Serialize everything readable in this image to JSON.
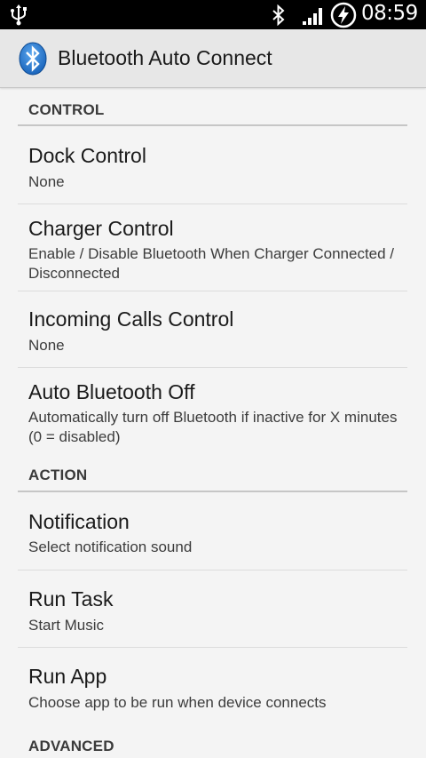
{
  "status_bar": {
    "time": "08:59",
    "icons": [
      "usb-icon",
      "bluetooth-icon",
      "signal-icon",
      "battery-charging-icon"
    ]
  },
  "action_bar": {
    "title": "Bluetooth Auto Connect",
    "icon": "bluetooth-app-icon",
    "accent_color": "#1e6fc5"
  },
  "categories": {
    "control": "CONTROL",
    "action": "ACTION",
    "advanced": "ADVANCED"
  },
  "prefs": {
    "dock_control": {
      "title": "Dock Control",
      "summary": "None"
    },
    "charger_control": {
      "title": "Charger Control",
      "summary": "Enable / Disable Bluetooth When Charger Connected / Disconnected"
    },
    "incoming_calls_control": {
      "title": "Incoming Calls Control",
      "summary": "None"
    },
    "auto_bluetooth_off": {
      "title": "Auto Bluetooth Off",
      "summary": "Automatically turn off Bluetooth if inactive for X minutes (0 = disabled)"
    },
    "notification": {
      "title": "Notification",
      "summary": "Select notification sound"
    },
    "run_task": {
      "title": "Run Task",
      "summary": "Start Music"
    },
    "run_app": {
      "title": "Run App",
      "summary": "Choose app to be run when device connects"
    }
  }
}
